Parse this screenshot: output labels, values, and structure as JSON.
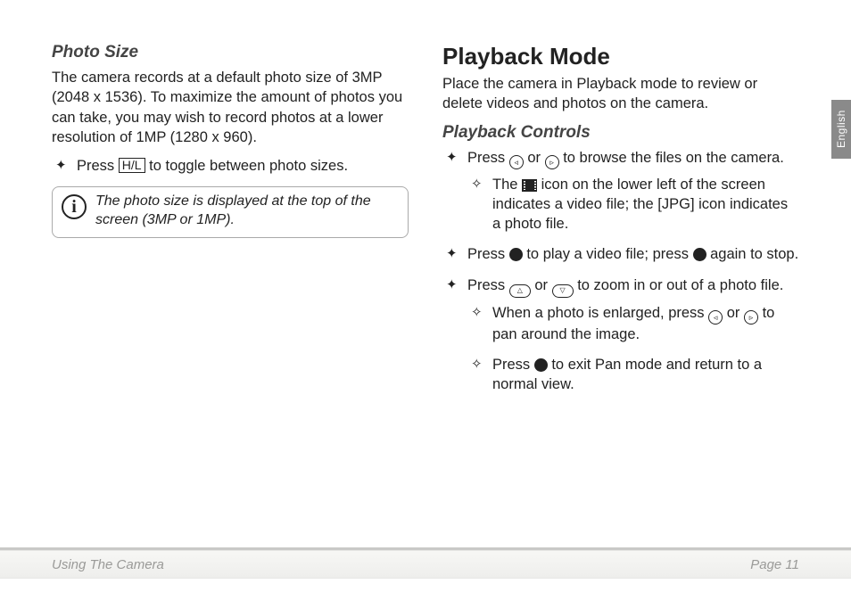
{
  "left": {
    "heading": "Photo Size",
    "body": "The camera records at a default photo size of 3MP (2048 x 1536). To maximize the amount of photos you can take, you may wish to record photos at a lower resolution of 1MP (1280 x 960).",
    "bullet1_a": "Press ",
    "bullet1_key": "H/L",
    "bullet1_b": " to toggle between photo sizes.",
    "info": "The photo size is displayed at the top of the screen (3MP or 1MP)."
  },
  "right": {
    "title": "Playback Mode",
    "intro": "Place the camera in Playback mode to review or delete videos and photos on the camera.",
    "controls_heading": "Playback Controls",
    "b1_a": "Press ",
    "b1_b": " or ",
    "b1_c": " to browse the files on the camera.",
    "b1_s1_a": "The ",
    "b1_s1_b": " icon on the lower left of the screen indicates a video file; the ",
    "b1_s1_jpg": "[JPG]",
    "b1_s1_c": " icon indicates a photo file.",
    "b2_a": "Press ",
    "b2_b": " to play a video file; press ",
    "b2_c": " again to stop.",
    "b3_a": "Press ",
    "b3_b": " or ",
    "b3_c": " to zoom in or out of a photo file.",
    "b3_s1_a": "When a photo is enlarged, press ",
    "b3_s1_b": " or ",
    "b3_s1_c": " to pan around the image.",
    "b3_s2_a": "Press ",
    "b3_s2_b": " to exit Pan mode and return to a normal view."
  },
  "side_tab": "English",
  "footer": {
    "left": "Using The Camera",
    "right": "Page 11"
  }
}
